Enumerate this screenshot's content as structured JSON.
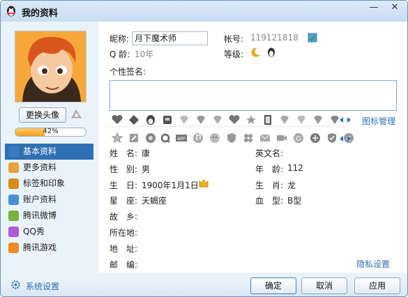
{
  "window": {
    "title": "我的资料",
    "minimize": "—",
    "close": "✕"
  },
  "left": {
    "change_avatar": "更换头像",
    "progress": {
      "text": "42%",
      "value": 0.42
    },
    "nav": [
      {
        "label": "基本资料",
        "icon": "id-card-icon",
        "color": "#3a7cc4"
      },
      {
        "label": "更多资料",
        "icon": "card-list-icon",
        "color": "#e6a23c"
      },
      {
        "label": "标签和印象",
        "icon": "tag-person-icon",
        "color": "#d98b1c"
      },
      {
        "label": "账户资料",
        "icon": "account-icon",
        "color": "#4a90d9"
      },
      {
        "label": "腾讯微博",
        "icon": "weibo-icon",
        "color": "#76b43c"
      },
      {
        "label": "QQ秀",
        "icon": "qqshow-icon",
        "color": "#b15ad9"
      },
      {
        "label": "腾讯游戏",
        "icon": "game-icon",
        "color": "#f08a24"
      }
    ]
  },
  "profile": {
    "nickname_label": "昵称:",
    "nickname_value": "月下魔术师",
    "account_label": "帐号:",
    "account_value": "119121818",
    "age_label": "Q 龄:",
    "age_value": "10年",
    "level_label": "等级:",
    "signature_label": "个性签名:",
    "signature_value": "",
    "icon_manage": "图标管理",
    "fields_left": [
      {
        "label": "姓　名:",
        "value": "康"
      },
      {
        "label": "性　别:",
        "value": "男"
      },
      {
        "label": "生　日:",
        "value": "1900年1月1日"
      },
      {
        "label": "星　座:",
        "value": "天蝎座"
      },
      {
        "label": "故　乡:",
        "value": ""
      },
      {
        "label": "所在地:",
        "value": ""
      },
      {
        "label": "地　址:",
        "value": ""
      },
      {
        "label": "邮　编:",
        "value": ""
      }
    ],
    "fields_right": [
      {
        "label": "英文名:",
        "value": ""
      },
      {
        "label": "年　龄:",
        "value": "112"
      },
      {
        "label": "生　肖:",
        "value": "龙"
      },
      {
        "label": "血　型:",
        "value": "B型"
      }
    ],
    "privacy": "隐私设置"
  },
  "footer": {
    "settings": "系统设置",
    "ok": "确定",
    "cancel": "取消",
    "apply": "应用"
  },
  "colors": {
    "accent": "#2f6fb3",
    "link": "#2a6fb8",
    "titlebar": "#c7ddf2"
  }
}
